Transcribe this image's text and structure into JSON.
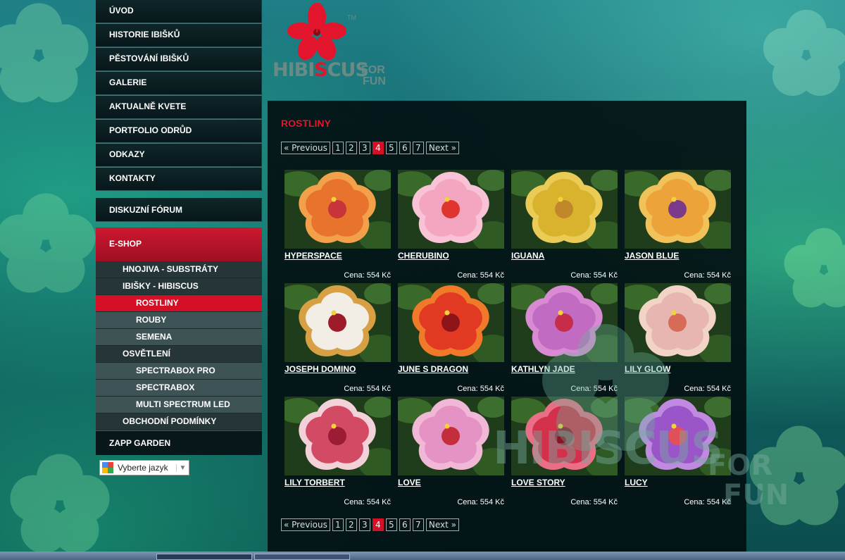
{
  "nav": {
    "items": [
      "ÚVOD",
      "HISTORIE IBIŠKŮ",
      "PĚSTOVÁNÍ IBIŠKŮ",
      "GALERIE",
      "AKTUALNĚ KVETE",
      "PORTFOLIO ODRŮD",
      "ODKAZY",
      "KONTAKTY"
    ],
    "forum": "DISKUZNÍ FÓRUM",
    "eshop": "E-SHOP",
    "shop_items": [
      {
        "label": "HNOJIVA - SUBSTRÁTY",
        "level": 1
      },
      {
        "label": "IBIŠKY - HIBISCUS",
        "level": 1
      },
      {
        "label": "ROSTLINY",
        "level": 2,
        "active": true
      },
      {
        "label": "ROUBY",
        "level": 2
      },
      {
        "label": "SEMENA",
        "level": 2
      },
      {
        "label": "OSVĚTLENÍ",
        "level": 1
      },
      {
        "label": "SPECTRABOX PRO",
        "level": 2
      },
      {
        "label": "SPECTRABOX",
        "level": 2
      },
      {
        "label": "MULTI SPECTRUM LED",
        "level": 2
      },
      {
        "label": "OBCHODNÍ PODMÍNKY",
        "level": 1
      }
    ],
    "zapp": "ZAPP GARDEN"
  },
  "language": {
    "label": "Vyberte jazyk"
  },
  "logo": {
    "name_a": "HIBI",
    "name_s": "S",
    "name_b": "CUS",
    "for": "FOR",
    "fun": "FUN",
    "tm": "TM"
  },
  "page": {
    "heading": "ROSTLINY"
  },
  "pager": {
    "prev": "« Previous",
    "pages": [
      "1",
      "2",
      "3",
      "4",
      "5",
      "6",
      "7"
    ],
    "current": "4",
    "next": "Next »"
  },
  "products": [
    {
      "name": "HYPERSPACE",
      "price": "Cena: 554 Kč",
      "petal": "#e8732c",
      "center": "#c7343a",
      "edge": "#f2a14a"
    },
    {
      "name": "CHERUBINO",
      "price": "Cena: 554 Kč",
      "petal": "#f4a5c0",
      "center": "#e0352f",
      "edge": "#f8c3d6"
    },
    {
      "name": "IGUANA",
      "price": "Cena: 554 Kč",
      "petal": "#d9b22e",
      "center": "#c0882a",
      "edge": "#e9cb55"
    },
    {
      "name": "JASON BLUE",
      "price": "Cena: 554 Kč",
      "petal": "#eba33a",
      "center": "#7c3a8a",
      "edge": "#f2c25a"
    },
    {
      "name": "JOSEPH DOMINO",
      "price": "Cena: 554 Kč",
      "petal": "#f2eee6",
      "center": "#9e1c2a",
      "edge": "#d8a044"
    },
    {
      "name": "JUNE S DRAGON",
      "price": "Cena: 554 Kč",
      "petal": "#e23a22",
      "center": "#8e1418",
      "edge": "#f07a2a"
    },
    {
      "name": "KATHLYN JADE",
      "price": "Cena: 554 Kč",
      "petal": "#c26bc2",
      "center": "#c62d4b",
      "edge": "#d88ad2"
    },
    {
      "name": "LILY GLOW",
      "price": "Cena: 554 Kč",
      "petal": "#e8b6b0",
      "center": "#d86b58",
      "edge": "#f1d4c6"
    },
    {
      "name": "LILY TORBERT",
      "price": "Cena: 554 Kč",
      "petal": "#d24a63",
      "center": "#9b1c34",
      "edge": "#f2d2d8"
    },
    {
      "name": "LOVE",
      "price": "Cena: 554 Kč",
      "petal": "#e592c4",
      "center": "#c42d3a",
      "edge": "#f1b7d6"
    },
    {
      "name": "LOVE STORY",
      "price": "Cena: 554 Kč",
      "petal": "#d3314b",
      "center": "#8a1324",
      "edge": "#ea6e86"
    },
    {
      "name": "LUCY",
      "price": "Cena: 554 Kč",
      "petal": "#9a55c8",
      "center": "#e1505a",
      "edge": "#c08ae0"
    }
  ],
  "watermark": {
    "line1": "HIBISCUS",
    "line2a": "FOR",
    "line2b": "FUN"
  }
}
